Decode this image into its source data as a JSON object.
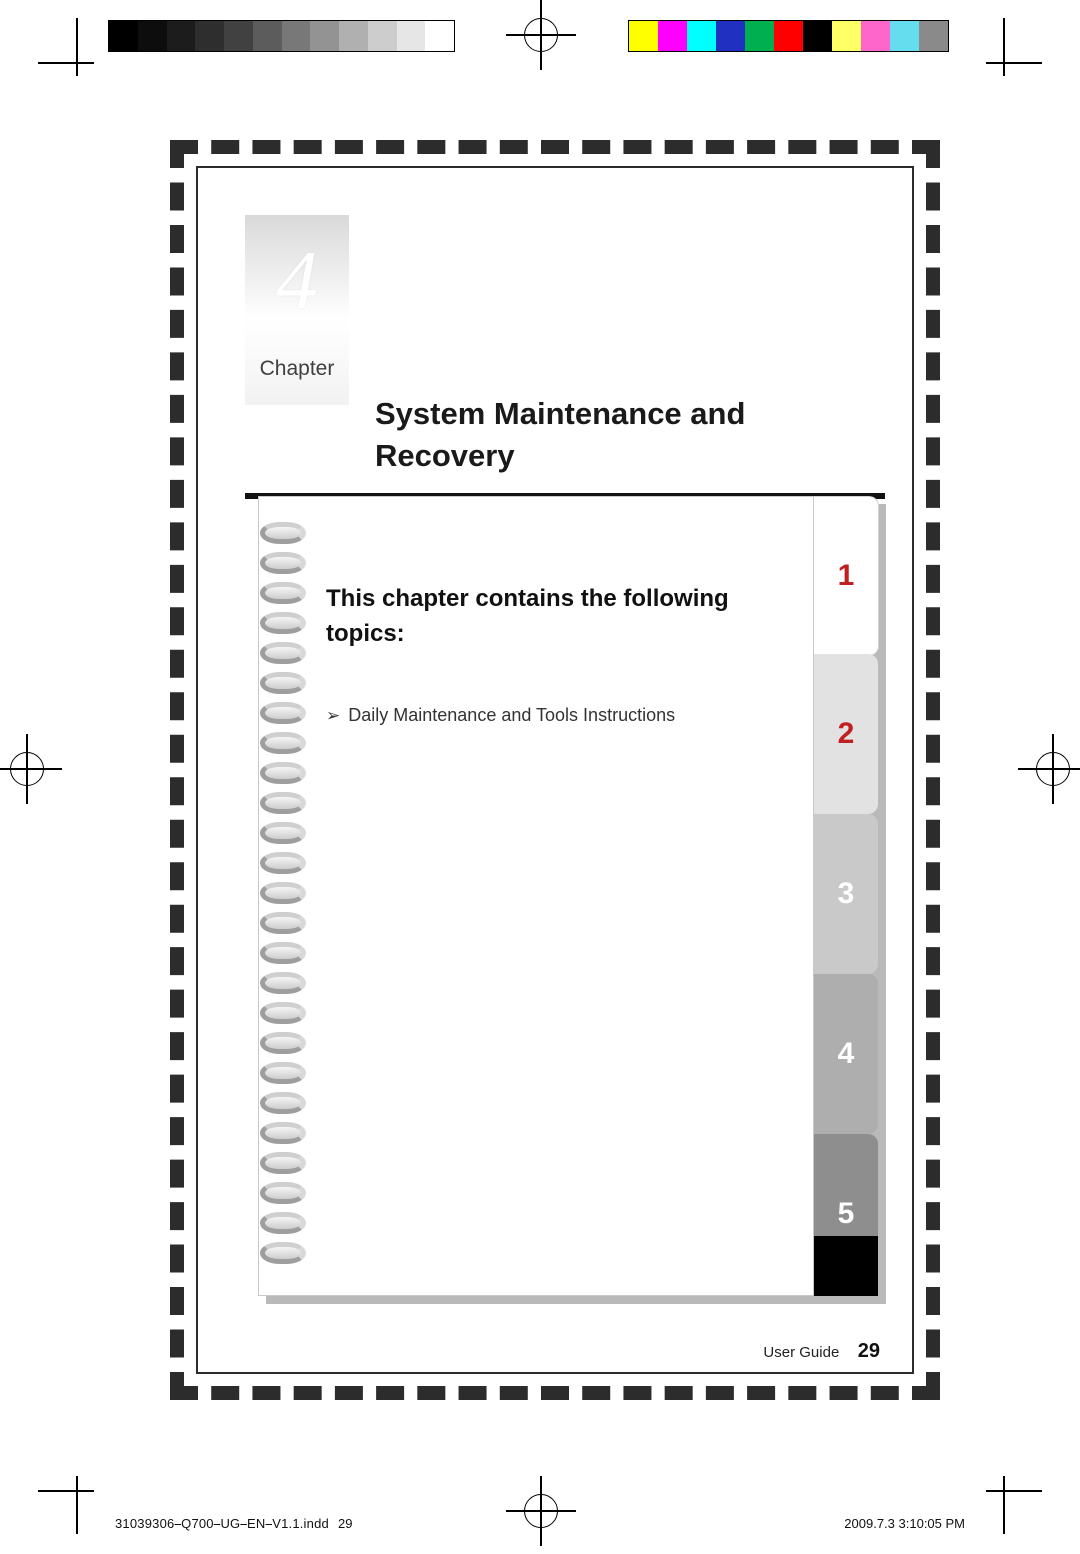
{
  "document": {
    "chapter": {
      "number": "4",
      "word": "Chapter",
      "title": "System Maintenance and Recovery"
    },
    "card": {
      "heading": "This chapter contains the following topics:",
      "bullet_glyph": "➢",
      "topics": [
        "Daily Maintenance and Tools Instructions"
      ]
    },
    "tabs": [
      {
        "label": "1",
        "color": "#ffffff",
        "text_color": "#d03030"
      },
      {
        "label": "2",
        "color": "#e0e0e0",
        "text_color": "#c02020"
      },
      {
        "label": "3",
        "color": "#c8c8c8",
        "text_color": "#ffffff"
      },
      {
        "label": "4",
        "color": "#b0b0b0",
        "text_color": "#ffffff"
      },
      {
        "label": "5",
        "color": "#909090",
        "text_color": "#ffffff"
      },
      {
        "label": "",
        "color": "#000000",
        "text_color": "#ffffff"
      }
    ],
    "footer": {
      "label": "User Guide",
      "page_number": "29"
    },
    "print_slug": {
      "filename": "31039306⎯Q700⎯UG⎯EN⎯V1.1.indd",
      "page": "29",
      "timestamp": "2009.7.3   3:10:05 PM"
    }
  },
  "calibration": {
    "grayscale_swatches": [
      "#000000",
      "#0d0d0d",
      "#1c1c1c",
      "#2e2e2e",
      "#414141",
      "#5c5c5c",
      "#787878",
      "#939393",
      "#b0b0b0",
      "#cdcdcd",
      "#e6e6e6",
      "#ffffff"
    ],
    "color_swatches": [
      "#ffff00",
      "#ff00ff",
      "#00ffff",
      "#2030c0",
      "#00b050",
      "#ff0000",
      "#000000",
      "#ffff66",
      "#ff66cc",
      "#66ddee",
      "#8a8a8a"
    ]
  }
}
